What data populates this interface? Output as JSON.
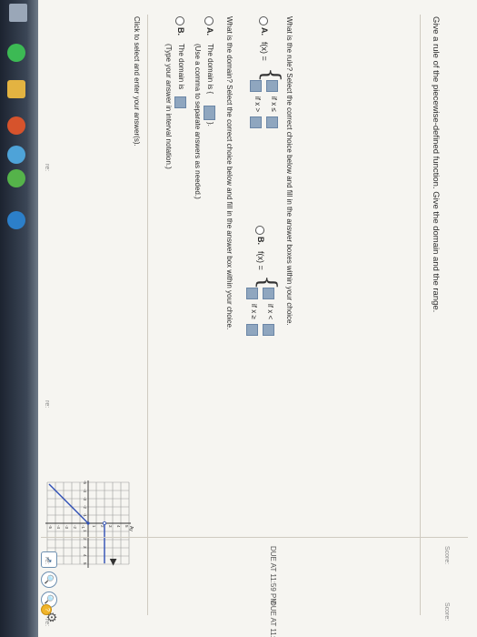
{
  "question": {
    "prompt": "Give a rule of the piecewise-defined function. Give the domain and the range.",
    "rule_prompt": "What is the rule? Select the correct choice below and fill in the answer boxes within your choice.",
    "choice_a": {
      "letter": "A.",
      "lhs": "f(x) =",
      "cond1": "if x ≤",
      "cond2": "if x >"
    },
    "choice_b": {
      "letter": "B.",
      "lhs": "f(x) =",
      "cond1": "if x <",
      "cond2": "if x ≥"
    },
    "domain_prompt": "What is the domain? Select the correct choice below and fill in the answer box within your choice.",
    "domain_a": {
      "letter": "A.",
      "text": "The domain is {",
      "close": "}.",
      "hint": "(Use a comma to separate answers as needed.)"
    },
    "domain_b": {
      "letter": "B.",
      "text": "The domain is",
      "hint": "(Type your answer in interval notation.)"
    },
    "footer": "Click to select and enter your answer(s)."
  },
  "graph": {
    "axis_y": "Ay",
    "y_ticks": [
      "5",
      "4",
      "3",
      "2",
      "1",
      "-1",
      "-2",
      "-3",
      "-4",
      "-5"
    ],
    "x_ticks": [
      "-5",
      "-4",
      "-3",
      "-2",
      "-1",
      "1",
      "2",
      "3",
      "4",
      "5"
    ],
    "line_color": "#2f4fb5"
  },
  "due": [
    "DUE AT 11:59 PM",
    "DUE AT 11:59 PM"
  ],
  "score": [
    "Score:",
    "Score:"
  ],
  "side_labels": [
    "re:",
    "re:",
    "re:",
    "re:"
  ],
  "colors": {
    "accent": "#2f5d8a",
    "blank": "#8fa6bf"
  }
}
